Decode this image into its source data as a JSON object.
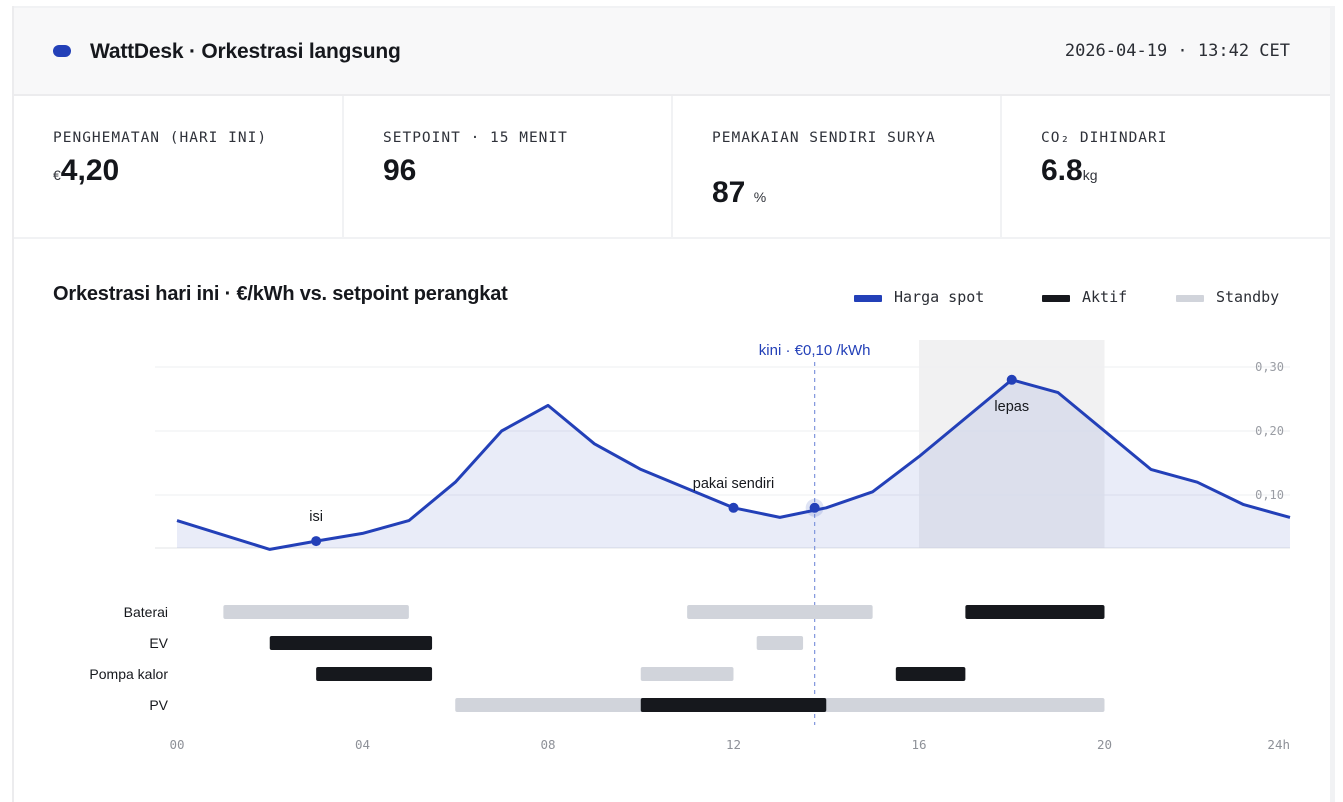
{
  "header": {
    "app_title": "WattDesk · Orkestrasi langsung",
    "datetime": "2026-04-19 · 13:42 CET",
    "status_color": "#2340b8"
  },
  "kpis": [
    {
      "label": "PENGHEMATAN (HARI INI)",
      "prefix": "€",
      "value": "4,20",
      "unit": ""
    },
    {
      "label": "SETPOINT · 15 MENIT",
      "prefix": "",
      "value": "96",
      "unit": ""
    },
    {
      "label": "PEMAKAIAN SENDIRI SURYA",
      "prefix": "",
      "value": "87",
      "unit": "%"
    },
    {
      "label": "CO₂ DIHINDARI",
      "prefix": "",
      "value": "6.8",
      "unit": "kg"
    }
  ],
  "chart": {
    "title": "Orkestrasi hari ini · €/kWh vs. setpoint perangkat",
    "legend": [
      {
        "label": "Harga spot",
        "color": "#2340b8"
      },
      {
        "label": "Aktif",
        "color": "#16181d"
      },
      {
        "label": "Standby",
        "color": "#d1d4db"
      }
    ]
  },
  "chart_data": {
    "type": "line",
    "title": "Orkestrasi hari ini · €/kWh vs. setpoint perangkat",
    "series": [
      {
        "name": "Harga spot",
        "x": [
          0,
          2,
          3,
          4,
          5,
          6,
          7,
          8,
          9,
          10,
          12,
          13,
          14,
          15,
          16,
          18,
          19,
          21,
          22,
          23,
          24
        ],
        "values": [
          0.06,
          0.015,
          0.028,
          0.04,
          0.06,
          0.12,
          0.2,
          0.24,
          0.18,
          0.14,
          0.08,
          0.065,
          0.08,
          0.105,
          0.16,
          0.28,
          0.26,
          0.14,
          0.12,
          0.085,
          0.065
        ]
      }
    ],
    "x_ticks": [
      "00",
      "04",
      "08",
      "12",
      "16",
      "20",
      "24h"
    ],
    "y_ticks": [
      "0,10",
      "0,20",
      "0,30"
    ],
    "y_tick_values": [
      0.1,
      0.2,
      0.3
    ],
    "xlim": [
      0,
      24
    ],
    "ylim": [
      -0.03,
      0.3
    ],
    "grid": true,
    "highlight_window": [
      16,
      20
    ],
    "now": {
      "x": 13.75,
      "y": 0.08,
      "label": "kini · €0,10 /kWh"
    },
    "annotations": [
      {
        "x": 3,
        "y": 0.028,
        "text": "isi",
        "pos": "above"
      },
      {
        "x": 12,
        "y": 0.08,
        "text": "pakai sendiri",
        "pos": "above"
      },
      {
        "x": 18,
        "y": 0.28,
        "text": "lepas",
        "pos": "below"
      }
    ],
    "devices": [
      {
        "name": "Baterai",
        "segments": [
          {
            "start": 1,
            "end": 5,
            "state": "standby"
          },
          {
            "start": 11,
            "end": 15,
            "state": "standby"
          },
          {
            "start": 17,
            "end": 20,
            "state": "aktif"
          }
        ]
      },
      {
        "name": "EV",
        "segments": [
          {
            "start": 2,
            "end": 5.5,
            "state": "aktif"
          },
          {
            "start": 12.5,
            "end": 13.5,
            "state": "standby"
          }
        ]
      },
      {
        "name": "Pompa kalor",
        "segments": [
          {
            "start": 3,
            "end": 5.5,
            "state": "aktif"
          },
          {
            "start": 10,
            "end": 12,
            "state": "standby"
          },
          {
            "start": 15.5,
            "end": 17,
            "state": "aktif"
          }
        ]
      },
      {
        "name": "PV",
        "segments": [
          {
            "start": 6,
            "end": 20,
            "state": "standby"
          },
          {
            "start": 10,
            "end": 14,
            "state": "aktif"
          }
        ]
      }
    ]
  }
}
